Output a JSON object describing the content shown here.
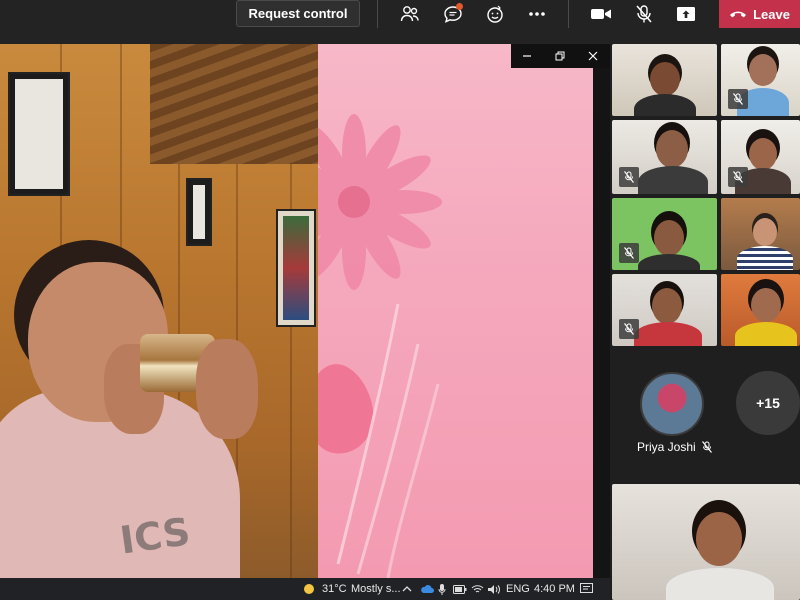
{
  "toolbar": {
    "request_control_label": "Request control",
    "leave_label": "Leave",
    "icons": [
      "people-icon",
      "chat-icon",
      "reactions-icon",
      "more-icon",
      "camera-icon",
      "mic-off-icon",
      "share-icon",
      "phone-hangup-icon"
    ],
    "leave_color": "#c4314b"
  },
  "shared_screen": {
    "shirt_text": "ICS"
  },
  "taskbar": {
    "temperature": "31°C",
    "weather": "Mostly s...",
    "language": "ENG",
    "time": "4:40 PM"
  },
  "participants": {
    "overflow_count": "+15",
    "featured_name": "Priya Joshi"
  }
}
